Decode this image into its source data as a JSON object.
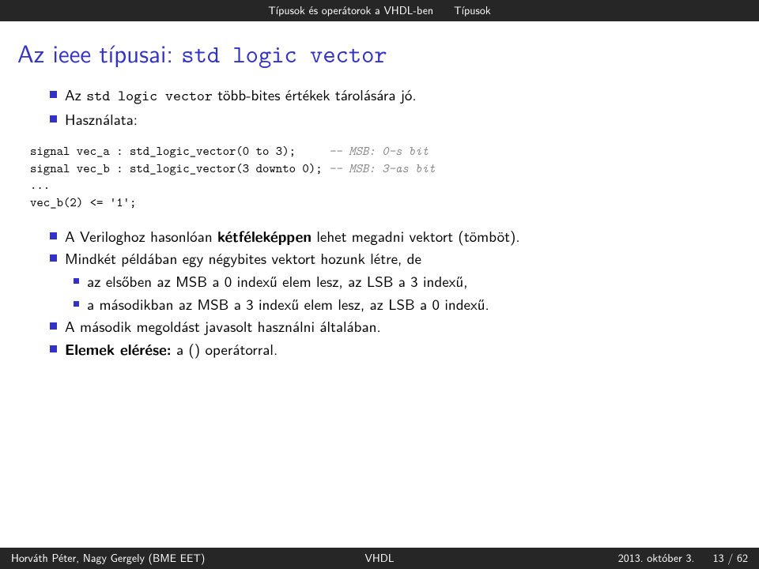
{
  "topbar": {
    "left": "Típusok és operátorok a VHDL-ben",
    "right": "Típusok"
  },
  "title": {
    "pre": "Az ieee típusai: ",
    "code": "std logic vector"
  },
  "b1": {
    "pre": "Az ",
    "code": "std logic vector",
    "post": " több-bites értékek tárolására jó."
  },
  "b2": "Használata:",
  "code": {
    "l1a": "signal vec_a : std_logic_vector(0 to 3);     ",
    "l1b": "-- MSB: 0-s bit",
    "l2a": "signal vec_b : std_logic_vector(3 downto 0); ",
    "l2b": "-- MSB: 3-as bit",
    "l3": "...",
    "l4": "vec_b(2) <= '1';"
  },
  "b3": {
    "pre": "A Veriloghoz hasonlóan ",
    "bold": "kétféleképpen",
    "post": " lehet megadni vektort (tömböt)."
  },
  "b4": "Mindkét példában egy négybites vektort hozunk létre, de",
  "b4a": "az elsőben az MSB a 0 indexű elem lesz, az LSB a 3 indexű,",
  "b4b": "a másodikban az MSB a 3 indexű elem lesz, az LSB a 0 indexű.",
  "b5": "A második megoldást javasolt használni általában.",
  "b6": {
    "bold": "Elemek elérése:",
    "post": " a () operátorral."
  },
  "footer": {
    "left": "Horváth Péter, Nagy Gergely (BME EET)",
    "mid": "VHDL",
    "right": "2013. október 3.     13 / 62"
  }
}
